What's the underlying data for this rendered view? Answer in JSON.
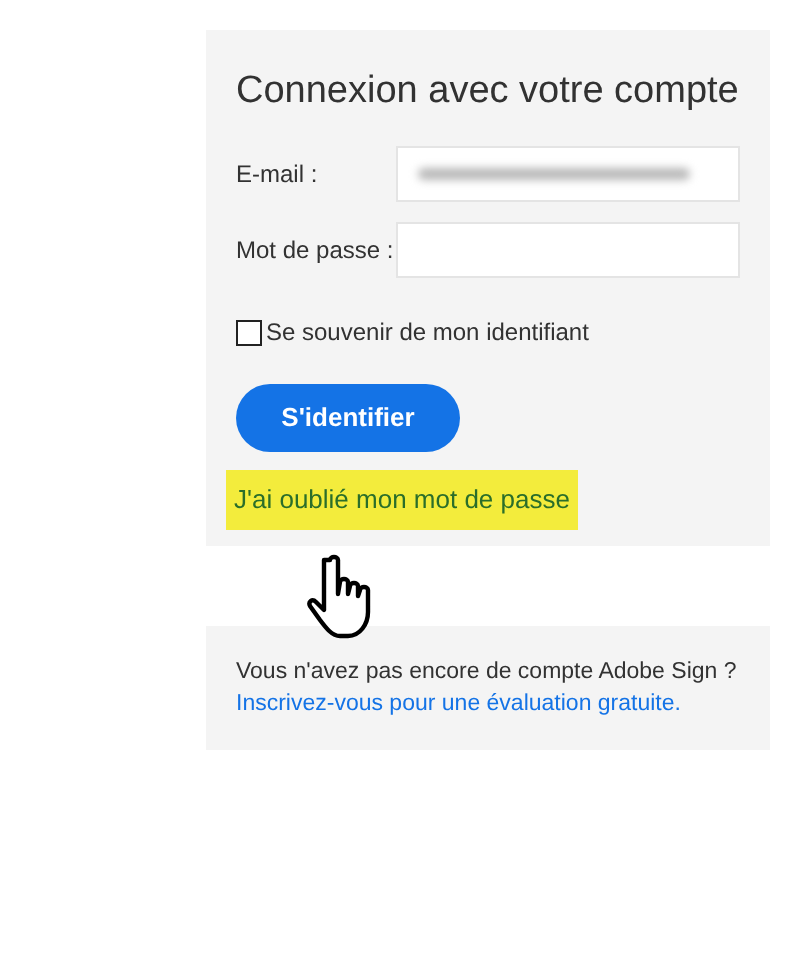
{
  "login": {
    "title": "Connexion avec votre compte",
    "fields": [
      {
        "label": "E-mail :",
        "kind": "redacted"
      },
      {
        "label": "Mot de passe :",
        "kind": "empty"
      }
    ],
    "remember": {
      "label": "Se souvenir de mon identifiant",
      "checked": false
    },
    "submit": "S'identifier",
    "forgot": {
      "label": "J'ai oublié mon mot de passe",
      "highlighted": true
    }
  },
  "signup": {
    "text": "Vous n'avez pas encore de compte Adobe Sign ?",
    "link": "Inscrivez-vous pour une évaluation gratuite."
  }
}
